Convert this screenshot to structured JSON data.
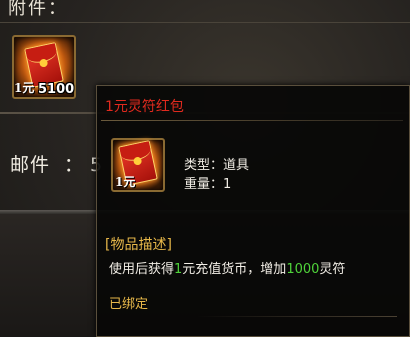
{
  "panel": {
    "attachment_label": "附件：",
    "attachment_item": {
      "icon": "red-envelope-icon",
      "badge": "1元",
      "count": "5100"
    },
    "mail_label": "邮件",
    "mail_colon": "：",
    "mail_value": "5"
  },
  "tooltip": {
    "title": "1元灵符红包",
    "title_color": "#e02a1e",
    "icon": "red-envelope-icon",
    "icon_badge": "1元",
    "type_label": "类型：",
    "type_value": "道具",
    "weight_label": "重量：",
    "weight_value": "1",
    "desc_header": "[物品描述]",
    "desc_part1": "使用后获得",
    "desc_hl1": "1",
    "desc_part2": "元充值货币，增加",
    "desc_hl2": "1000",
    "desc_part3": "灵符",
    "bound_text": "已绑定",
    "highlight_color": "#4fd33a",
    "accent_color": "#e7b84a"
  }
}
